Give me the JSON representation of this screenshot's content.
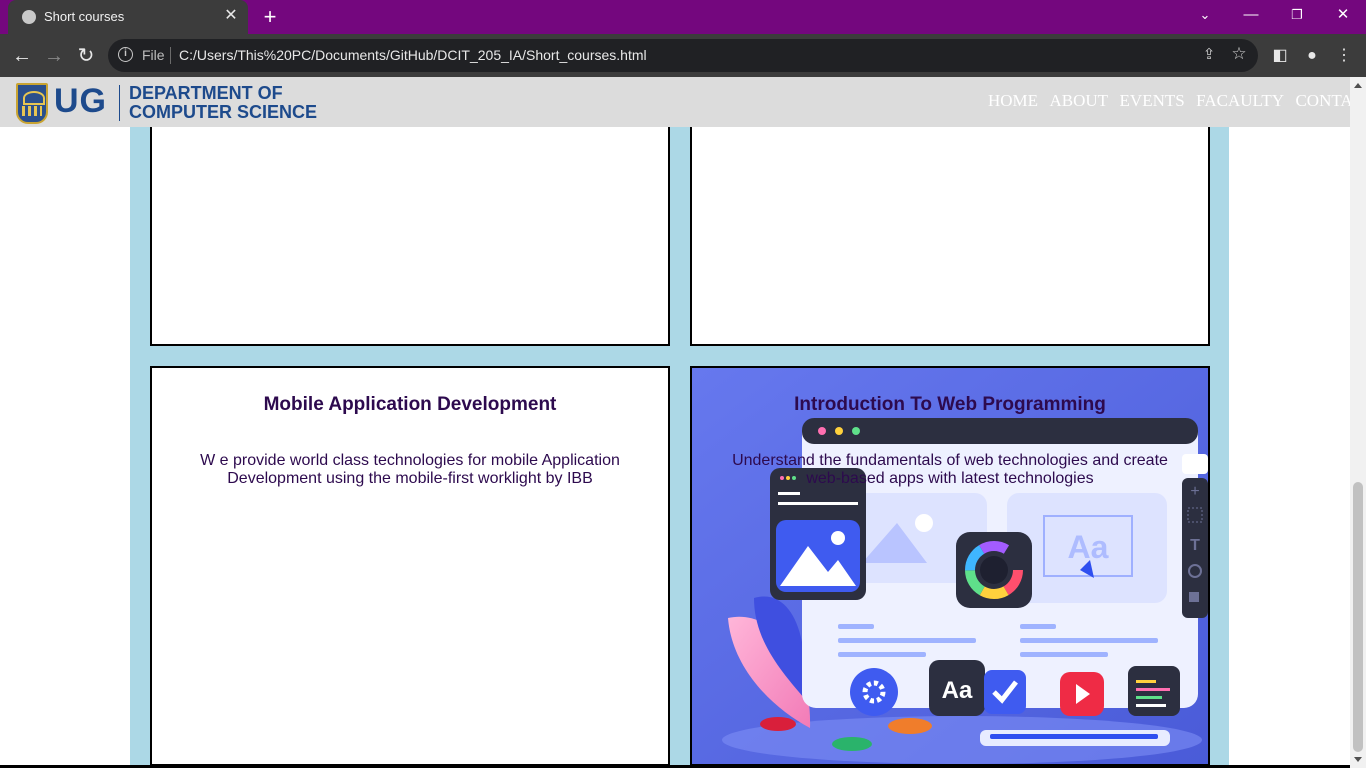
{
  "browser": {
    "tab_title": "Short courses",
    "url_scheme": "File",
    "url": "C:/Users/This%20PC/Documents/GitHub/DCIT_205_IA/Short_courses.html"
  },
  "header": {
    "logo_text": "UG",
    "dept_line1": "DEPARTMENT OF",
    "dept_line2": "COMPUTER SCIENCE",
    "nav": [
      "HOME",
      "ABOUT",
      "EVENTS",
      "FACAULTY",
      "CONTACT"
    ]
  },
  "courses": [
    {
      "title": "Mobile Application Development",
      "description": "W e provide world class technologies for mobile Application Development using the mobile-first worklight by IBB"
    },
    {
      "title": "Introduction To Web Programming",
      "description": "Understand the fundamentals of web technologies and create web-based apps with latest technologies"
    }
  ],
  "illustration": {
    "font_tile": "Aa",
    "canvas_text": "Aa"
  },
  "colors": {
    "browser_frame": "#74077e",
    "band": "#acd8e6",
    "text": "#2d0a4e",
    "brand": "#1d4a8c",
    "illustration_bg": "#5b6ee6"
  }
}
